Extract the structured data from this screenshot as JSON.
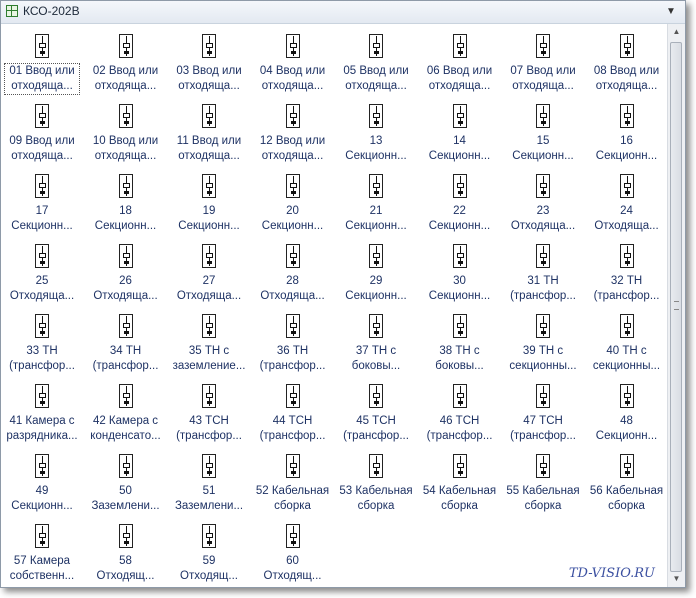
{
  "window": {
    "title": "КСО-202В",
    "collapse_glyph": "▼",
    "app_icon": "grid-stencil-icon"
  },
  "shapes": [
    [
      "01 Ввод или",
      "отходяща..."
    ],
    [
      "02 Ввод или",
      "отходяща..."
    ],
    [
      "03 Ввод или",
      "отходяща..."
    ],
    [
      "04 Ввод или",
      "отходяща..."
    ],
    [
      "05 Ввод или",
      "отходяща..."
    ],
    [
      "06 Ввод или",
      "отходяща..."
    ],
    [
      "07 Ввод или",
      "отходяща..."
    ],
    [
      "08 Ввод или",
      "отходяща..."
    ],
    [
      "09 Ввод или",
      "отходяща..."
    ],
    [
      "10 Ввод или",
      "отходяща..."
    ],
    [
      "11 Ввод или",
      "отходяща..."
    ],
    [
      "12 Ввод или",
      "отходяща..."
    ],
    [
      "13",
      "Секционн..."
    ],
    [
      "14",
      "Секционн..."
    ],
    [
      "15",
      "Секционн..."
    ],
    [
      "16",
      "Секционн..."
    ],
    [
      "17",
      "Секционн..."
    ],
    [
      "18",
      "Секционн..."
    ],
    [
      "19",
      "Секционн..."
    ],
    [
      "20",
      "Секционн..."
    ],
    [
      "21",
      "Секционн..."
    ],
    [
      "22",
      "Секционн..."
    ],
    [
      "23",
      "Отходяща..."
    ],
    [
      "24",
      "Отходяща..."
    ],
    [
      "25",
      "Отходяща..."
    ],
    [
      "26",
      "Отходяща..."
    ],
    [
      "27",
      "Отходяща..."
    ],
    [
      "28",
      "Отходяща..."
    ],
    [
      "29",
      "Секционн..."
    ],
    [
      "30",
      "Секционн..."
    ],
    [
      "31 ТН",
      "(трансфор..."
    ],
    [
      "32 ТН",
      "(трансфор..."
    ],
    [
      "33 ТН",
      "(трансфор..."
    ],
    [
      "34 ТН",
      "(трансфор..."
    ],
    [
      "35 ТН с",
      "заземление..."
    ],
    [
      "36 ТН",
      "(трансфор..."
    ],
    [
      "37 ТН с",
      "боковы..."
    ],
    [
      "38 ТН с",
      "боковы..."
    ],
    [
      "39 ТН с",
      "секционны..."
    ],
    [
      "40 ТН с",
      "секционны..."
    ],
    [
      "41 Камера с",
      "разрядника..."
    ],
    [
      "42 Камера с",
      "конденсато..."
    ],
    [
      "43 ТСН",
      "(трансфор..."
    ],
    [
      "44 ТСН",
      "(трансфор..."
    ],
    [
      "45 ТСН",
      "(трансфор..."
    ],
    [
      "46 ТСН",
      "(трансфор..."
    ],
    [
      "47 ТСН",
      "(трансфор..."
    ],
    [
      "48",
      "Секционн..."
    ],
    [
      "49",
      "Секционн..."
    ],
    [
      "50",
      "Заземлени..."
    ],
    [
      "51",
      "Заземлени..."
    ],
    [
      "52 Кабельная",
      "сборка"
    ],
    [
      "53 Кабельная",
      "сборка"
    ],
    [
      "54 Кабельная",
      "сборка"
    ],
    [
      "55 Кабельная",
      "сборка"
    ],
    [
      "56 Кабельная",
      "сборка"
    ],
    [
      "57 Камера",
      "собственн..."
    ],
    [
      "58",
      "Отходящ..."
    ],
    [
      "59",
      "Отходящ..."
    ],
    [
      "60",
      "Отходящ..."
    ]
  ],
  "selected_index": 0,
  "watermark": "TD-VISIO.RU",
  "scrollbar": {
    "up_glyph": "▲",
    "down_glyph": "▼"
  }
}
